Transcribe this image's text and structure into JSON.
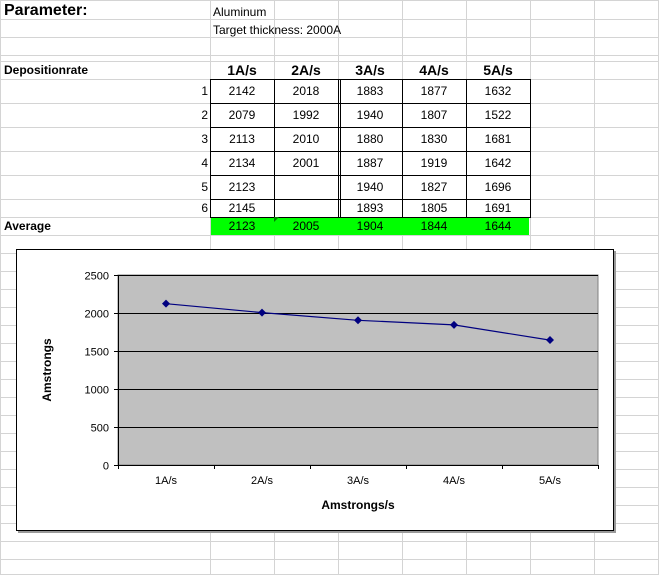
{
  "sheet": {
    "parameter_label": "Parameter:",
    "material": "Aluminum",
    "target": "Target thickness: 2000A",
    "rate_label": "Depositionrate",
    "average_label": "Average",
    "highlight_color": "#00ff00"
  },
  "table": {
    "headers": [
      "1A/s",
      "2A/s",
      "3A/s",
      "4A/s",
      "5A/s"
    ],
    "row_numbers": [
      "1",
      "2",
      "3",
      "4",
      "5",
      "6"
    ],
    "rows": [
      [
        "2142",
        "2018",
        "1883",
        "1877",
        "1632"
      ],
      [
        "2079",
        "1992",
        "1940",
        "1807",
        "1522"
      ],
      [
        "2113",
        "2010",
        "1880",
        "1830",
        "1681"
      ],
      [
        "2134",
        "2001",
        "1887",
        "1919",
        "1642"
      ],
      [
        "2123",
        "",
        "1940",
        "1827",
        "1696"
      ],
      [
        "2145",
        "",
        "1893",
        "1805",
        "1691"
      ]
    ],
    "averages": [
      "2123",
      "2005",
      "1904",
      "1844",
      "1644"
    ]
  },
  "chart_data": {
    "type": "line",
    "categories": [
      "1A/s",
      "2A/s",
      "3A/s",
      "4A/s",
      "5A/s"
    ],
    "values": [
      2123,
      2005,
      1904,
      1844,
      1644
    ],
    "xlabel": "Amstrongs/s",
    "ylabel": "Amstrongs",
    "ylim": [
      0,
      2500
    ],
    "yticks": [
      "0",
      "500",
      "1000",
      "1500",
      "2000",
      "2500"
    ],
    "grid": true,
    "legend": "none",
    "plot_bg": "#c0c0c0",
    "line_color": "#000080"
  }
}
